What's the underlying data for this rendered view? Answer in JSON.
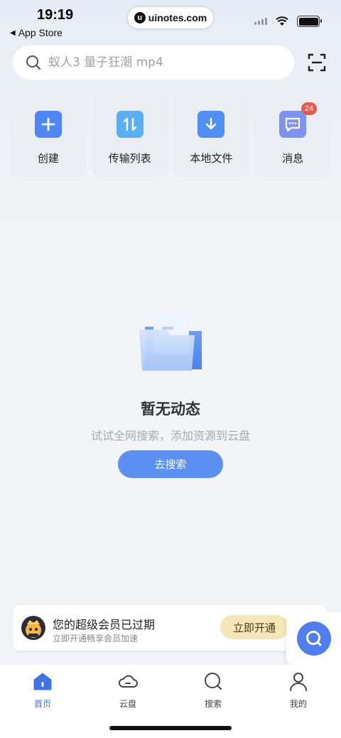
{
  "status_bar": {
    "time": "19:19",
    "back_app": "App Store",
    "url": "uinotes.com",
    "url_logo": "u"
  },
  "search": {
    "placeholder": "蚁人3 量子狂潮 mp4",
    "icon": "search-icon",
    "scan_icon": "scan-icon"
  },
  "quick_actions": [
    {
      "label": "创建",
      "icon": "plus-icon",
      "color": "#4f86f5"
    },
    {
      "label": "传输列表",
      "icon": "transfer-icon",
      "color": "#5aaef5"
    },
    {
      "label": "本地文件",
      "icon": "download-icon",
      "color": "#4f8ef5"
    },
    {
      "label": "消息",
      "icon": "message-icon",
      "color": "#7b93ef",
      "badge": "24"
    }
  ],
  "empty": {
    "title": "暂无动态",
    "subtitle": "试试全网搜索，添加资源到云盘",
    "button": "去搜索"
  },
  "vip": {
    "title": "您的超级会员已过期",
    "subtitle": "立即开通畅享会员加速",
    "button": "立即开通"
  },
  "tabs": [
    {
      "label": "首页",
      "icon": "home-icon",
      "active": true
    },
    {
      "label": "云盘",
      "icon": "cloud-icon",
      "active": false
    },
    {
      "label": "搜索",
      "icon": "search-tab-icon",
      "active": false
    },
    {
      "label": "我的",
      "icon": "profile-icon",
      "active": false
    }
  ],
  "colors": {
    "accent": "#4f7ef0",
    "vip_button": "#f6e6b8",
    "badge": "#e85a4f"
  }
}
